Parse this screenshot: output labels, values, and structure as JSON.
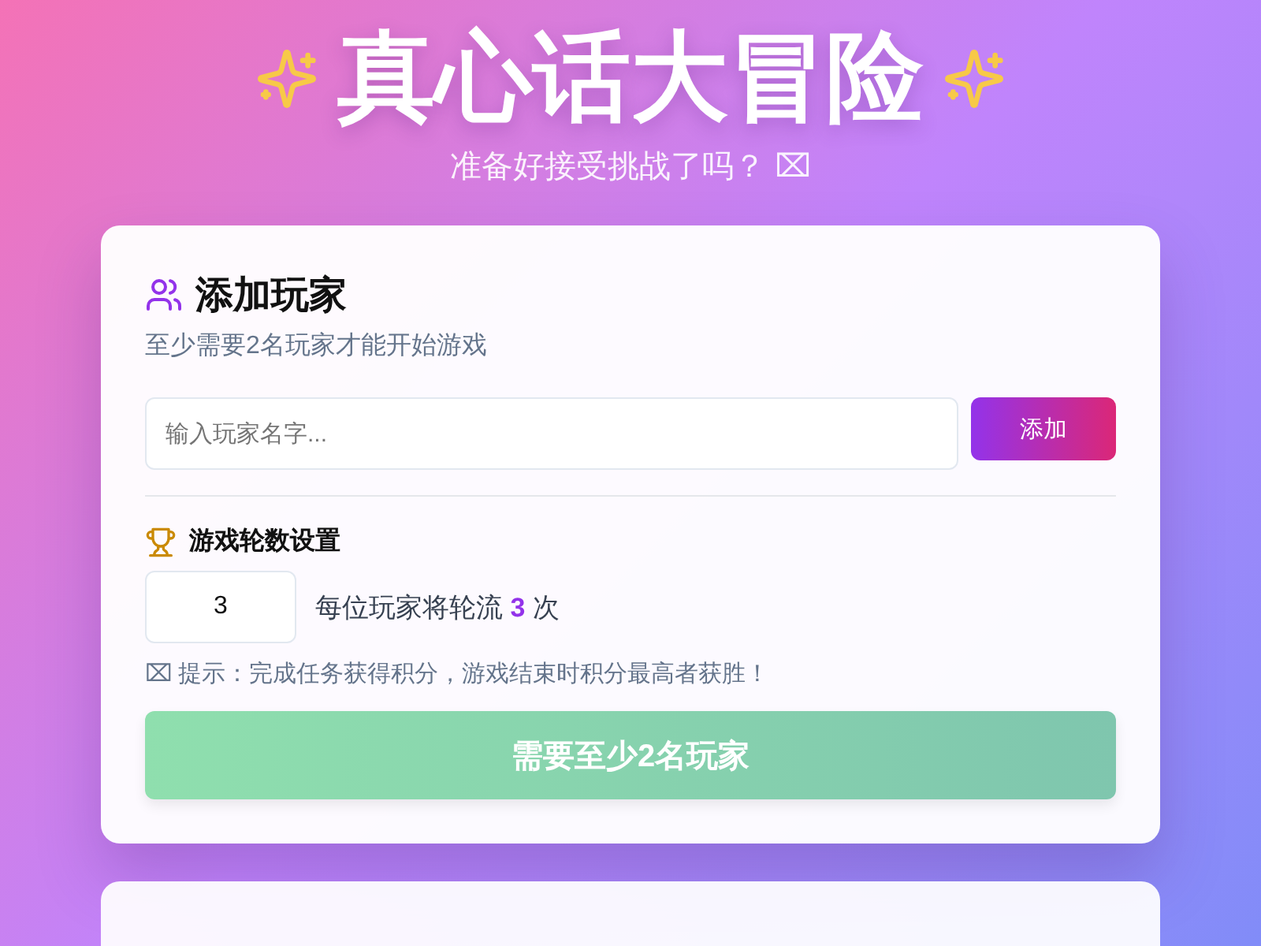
{
  "header": {
    "title": "真心话大冒险",
    "subtitle": "准备好接受挑战了吗？ ⌧"
  },
  "add_player": {
    "title": "添加玩家",
    "description": "至少需要2名玩家才能开始游戏",
    "name_field": {
      "placeholder": "输入玩家名字..."
    },
    "add_button": "添加"
  },
  "rounds": {
    "title": "游戏轮数设置",
    "value": "3",
    "description": "每位玩家将轮流 **3** 次",
    "tip": "⌧ 提示：完成任务获得积分，游戏结束时积分最高者获胜！"
  },
  "start_button": {
    "label": "需要至少2名玩家",
    "disabled": true
  }
}
